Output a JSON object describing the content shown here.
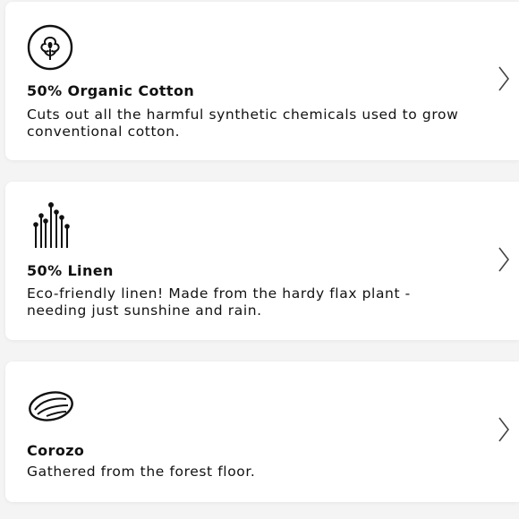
{
  "materials": [
    {
      "title": "50% Organic Cotton",
      "description": "Cuts out all the harmful synthetic chemicals used to grow conventional cotton.",
      "icon": "cotton-icon"
    },
    {
      "title": "50% Linen",
      "description": "Eco-friendly linen! Made from the hardy flax plant - needing just sunshine and rain.",
      "icon": "flax-icon"
    },
    {
      "title": "Corozo",
      "description": "Gathered from the forest floor.",
      "icon": "corozo-nut-icon"
    }
  ],
  "chevron_icon": "chevron-right-icon"
}
